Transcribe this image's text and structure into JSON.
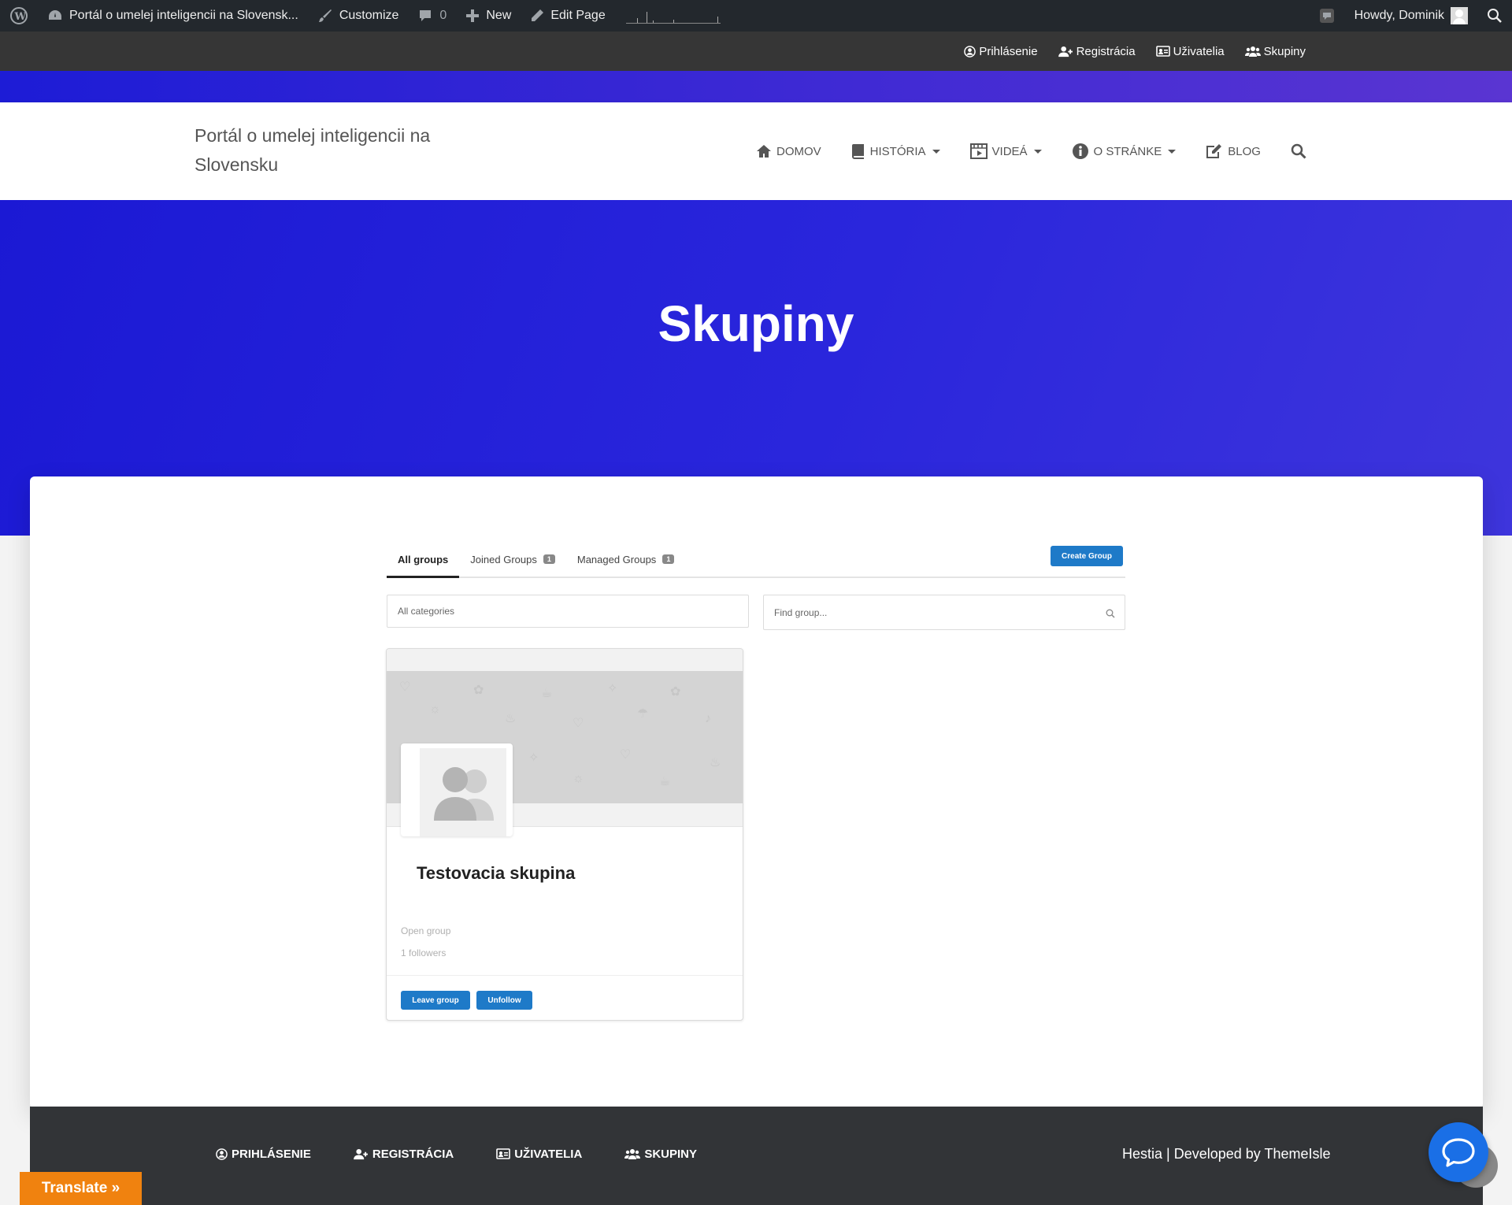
{
  "admin_bar": {
    "site_name": "Portál o umelej inteligencii na Slovensk...",
    "customize": "Customize",
    "comments_count": "0",
    "new": "New",
    "edit_page": "Edit Page",
    "howdy": "Howdy, Dominik"
  },
  "top_menu": {
    "login": "Prihlásenie",
    "register": "Registrácia",
    "users": "Uživatelia",
    "groups": "Skupiny"
  },
  "header": {
    "site_title": "Portál o umelej inteligencii na Slovensku",
    "nav": {
      "home": "DOMOV",
      "history": "HISTÓRIA",
      "videos": "VIDEÁ",
      "about": "O STRÁNKE",
      "blog": "BLOG"
    }
  },
  "hero": {
    "title": "Skupiny"
  },
  "groups": {
    "tabs": {
      "all": "All groups",
      "joined": "Joined Groups",
      "joined_count": "1",
      "managed": "Managed Groups",
      "managed_count": "1"
    },
    "create_button": "Create Group",
    "category_select": "All categories",
    "search_placeholder": "Find group...",
    "card": {
      "title": "Testovacia skupina",
      "type": "Open group",
      "followers": "1 followers",
      "leave_button": "Leave group",
      "unfollow_button": "Unfollow"
    }
  },
  "footer": {
    "nav": {
      "login": "PRIHLÁSENIE",
      "register": "REGISTRÁCIA",
      "users": "UŽIVATELIA",
      "groups": "SKUPINY"
    },
    "credit": "Hestia | Developed by ThemeIsle"
  },
  "translate_button": "Translate »",
  "colors": {
    "hero": "#1b19d4",
    "accent_button": "#1e7ac8",
    "footer": "#323437",
    "translate": "#f0820f",
    "chat": "#1a6fe6"
  }
}
